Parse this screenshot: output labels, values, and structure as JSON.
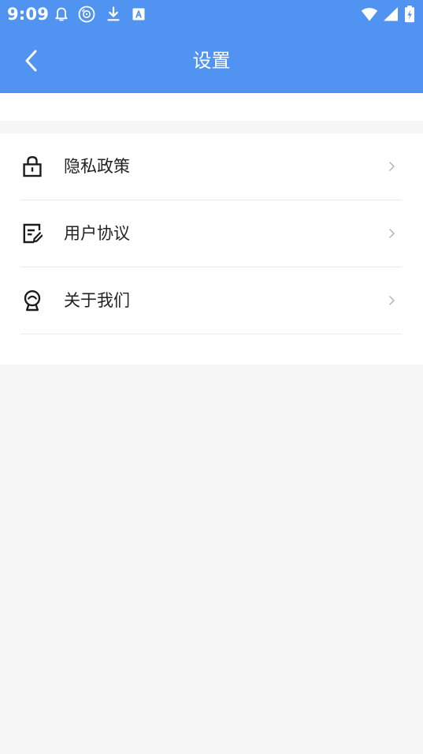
{
  "status_bar": {
    "time": "9:09",
    "left_icons": [
      "notification-bell-icon",
      "disc-icon",
      "download-icon",
      "keyboard-a-icon"
    ],
    "right_icons": [
      "wifi-icon",
      "cell-signal-icon",
      "battery-charging-icon"
    ]
  },
  "header": {
    "title": "设置",
    "back_icon": "chevron-left-icon",
    "background_color": "#5193f1"
  },
  "settings": {
    "items": [
      {
        "label": "隐私政策",
        "icon": "lock-icon"
      },
      {
        "label": "用户协议",
        "icon": "edit-document-icon"
      },
      {
        "label": "关于我们",
        "icon": "badge-icon"
      }
    ]
  }
}
